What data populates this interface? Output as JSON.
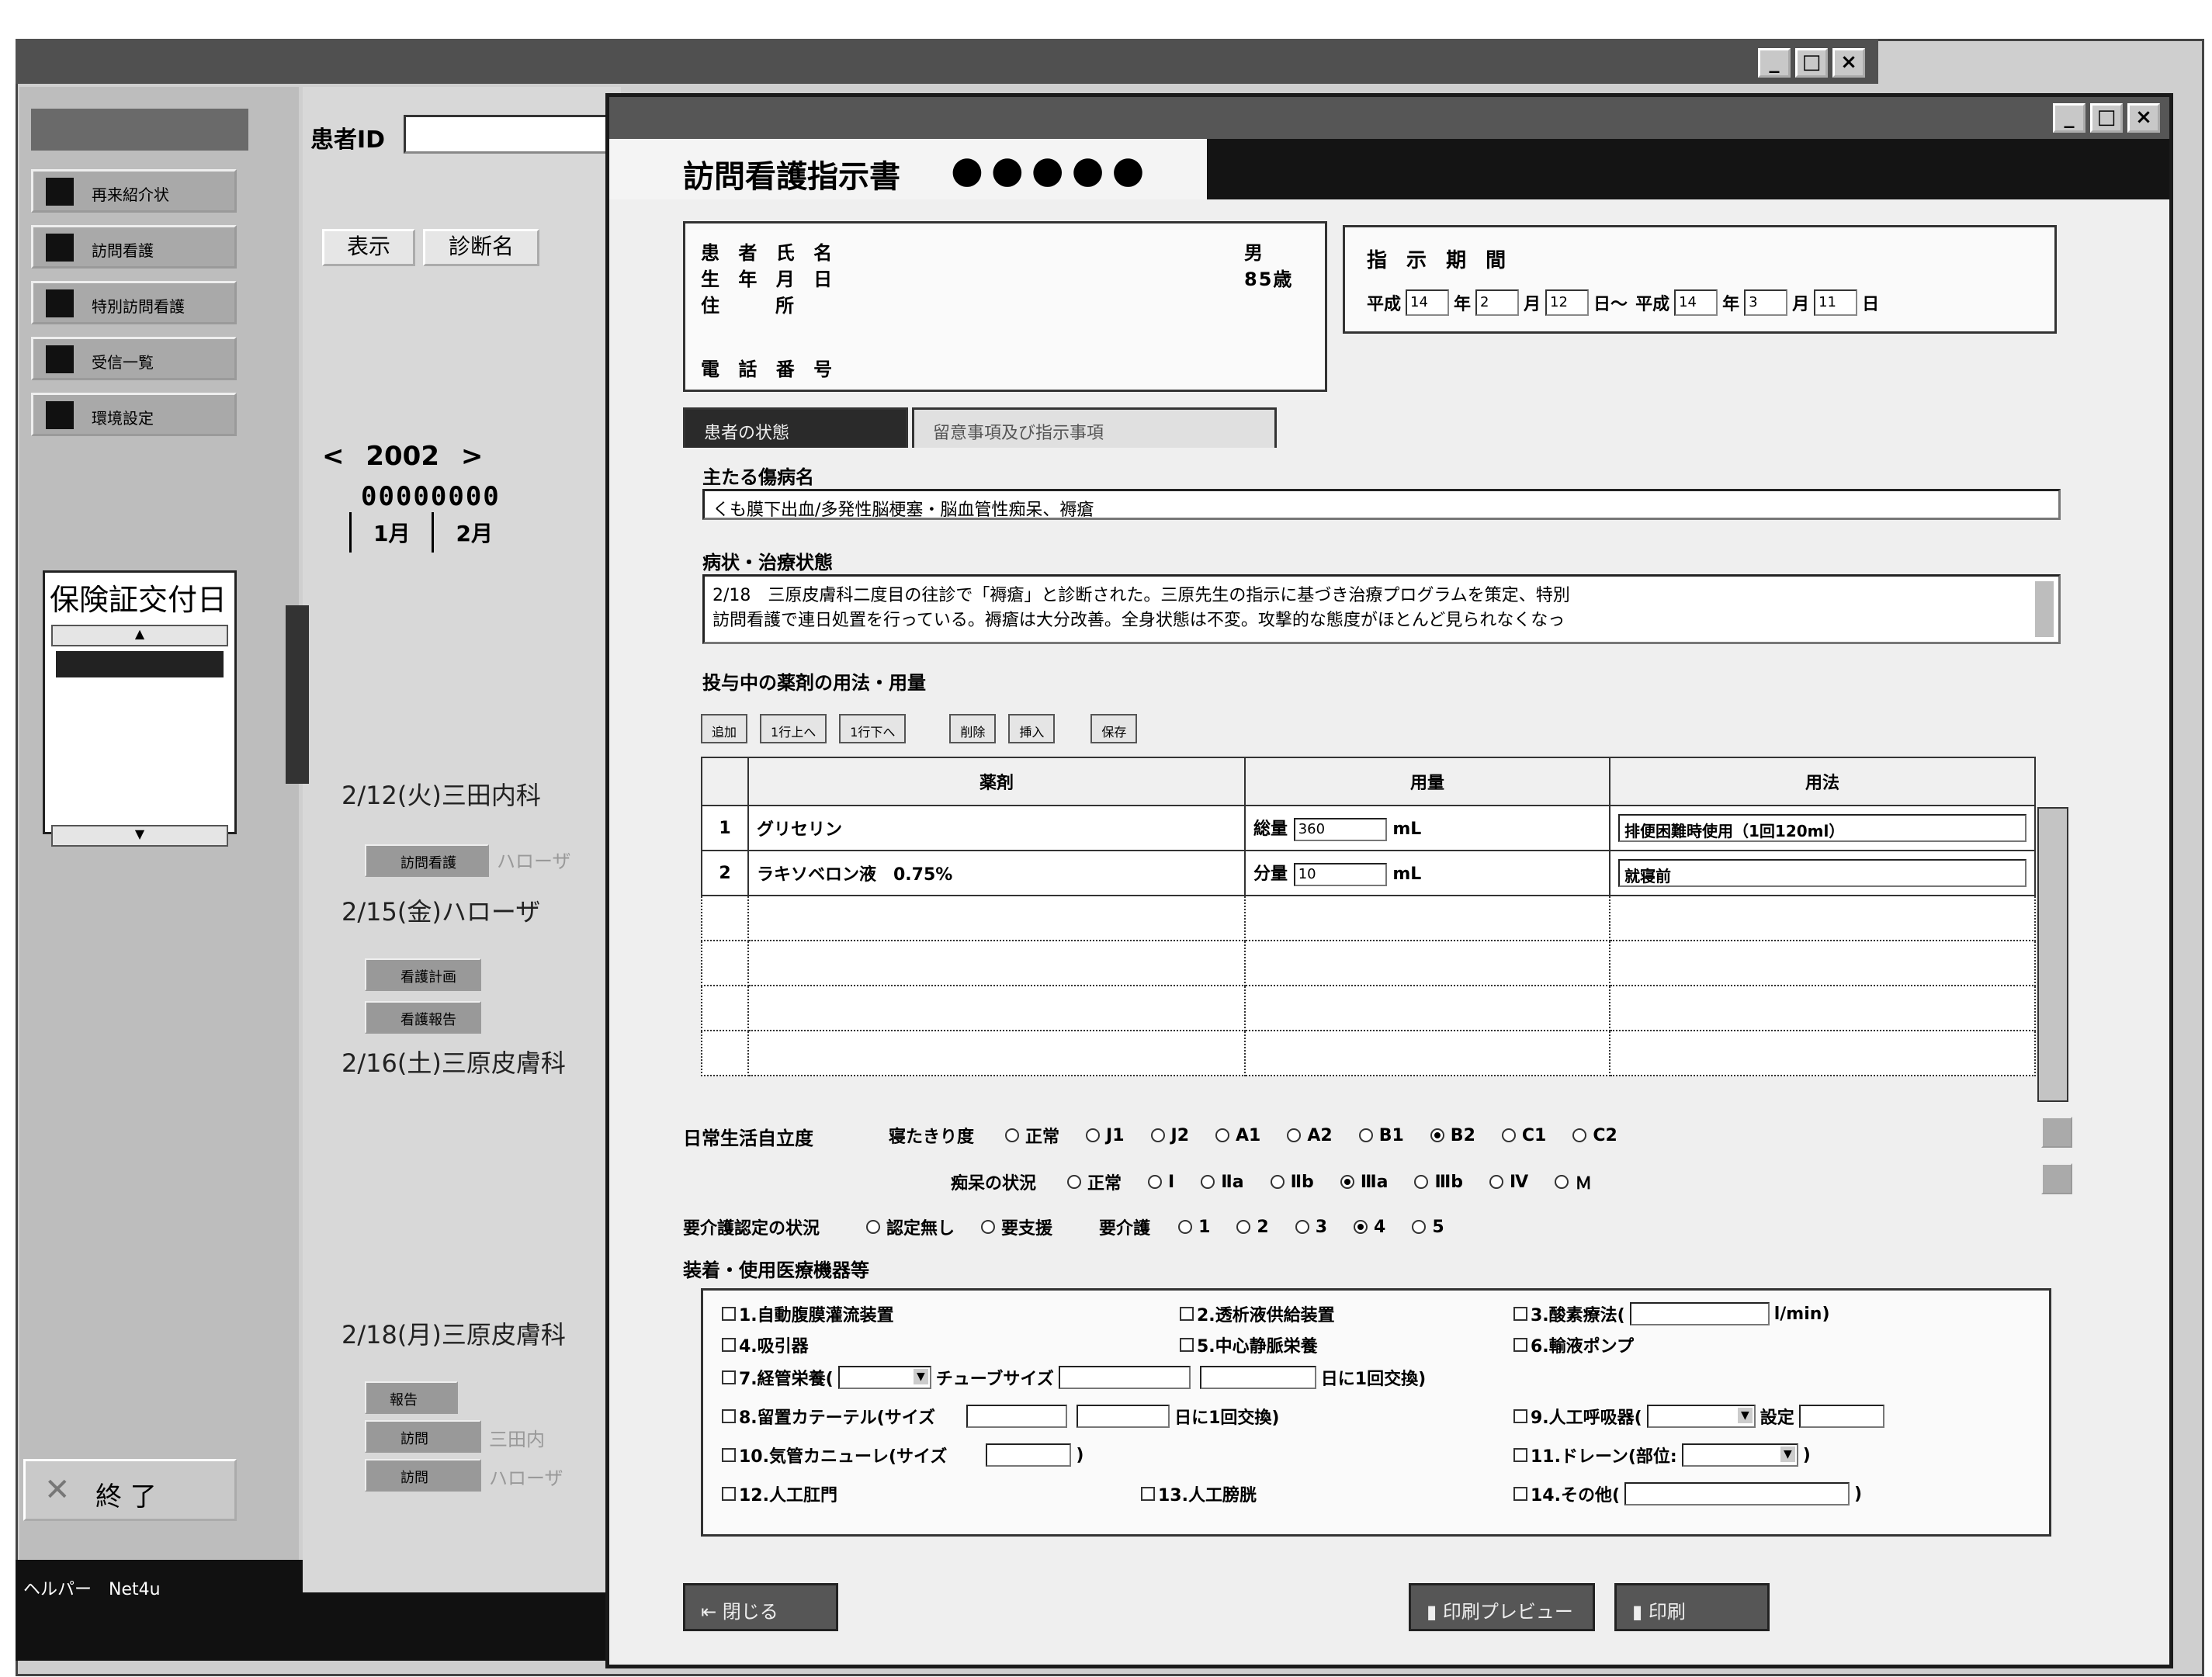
{
  "background_app": {
    "minimize_label": "_",
    "maximize_label": "□",
    "close_label": "×",
    "patient_id_label": "患者ID",
    "nav_items": [
      "再来紹介状",
      "訪問看護",
      "特別訪問看護",
      "受信一覧",
      "環境設定"
    ],
    "display_button": "表示",
    "diagnosis_button": "診断名",
    "year": "2002",
    "year_prev": "<",
    "year_next": ">",
    "digits_row": "00000000",
    "months": [
      "1月",
      "2月"
    ],
    "card_title": "保険証交付日",
    "card_up": "▲",
    "card_down": "▼",
    "schedule": [
      {
        "date": "2/12(火)三田内科"
      },
      {
        "date": "2/15(金)ハローザ"
      },
      {
        "date": "2/16(土)三原皮膚科"
      },
      {
        "date": "2/18(月)三原皮膚科"
      }
    ],
    "schedule_buttons": [
      "訪問看護",
      "看護計画",
      "看護報告",
      "報告",
      "訪問"
    ],
    "schedule_tags": [
      "ハローザ",
      "三田内",
      "ハローザ"
    ],
    "exit_label": "終 了",
    "taskbar_text": "ヘルパー　Net4u"
  },
  "dialog": {
    "minimize_label": "_",
    "maximize_label": "□",
    "close_label": "×",
    "header_title": "訪問看護指示書",
    "header_dots": "●●●●●",
    "patient": {
      "name_label": "患 者 氏 名",
      "sex_value": "男",
      "dob_label": "生 年 月 日",
      "age_value": "85歳",
      "address_label": "住　　所",
      "phone_label": "電 話 番 号"
    },
    "period": {
      "title": "指 示 期 間",
      "era1": "平成",
      "year1": "14",
      "year_unit1": "年",
      "month1": "2",
      "month_unit1": "月",
      "day1": "12",
      "day_unit1": "日～",
      "era2": "平成",
      "year2": "14",
      "year_unit2": "年",
      "month2": "3",
      "month_unit2": "月",
      "day2": "11",
      "day_unit2": "日"
    },
    "tabs": [
      "患者の状態",
      "留意事項及び指示事項"
    ],
    "main_disease_label": "主たる傷病名",
    "main_disease_value": "くも膜下出血/多発性脳梗塞・脳血管性痴呆、褥瘡",
    "condition_label": "病状・治療状態",
    "condition_line1": "2/18　三原皮膚科二度目の往診で「褥瘡」と診断された。三原先生の指示に基づき治療プログラムを策定、特別",
    "condition_line2": "訪問看護で連日処置を行っている。褥瘡は大分改善。全身状態は不変。攻撃的な態度がほとんど見られなくなっ",
    "med_label": "投与中の薬剤の用法・用量",
    "toolbar": [
      "追加",
      "1行上へ",
      "1行下へ",
      "削除",
      "挿入",
      "保存"
    ],
    "table": {
      "headers": [
        "薬剤",
        "用量",
        "用法"
      ],
      "rows": [
        {
          "num": "1",
          "drug": "グリセリン",
          "dose_prefix": "総量",
          "dose_value": "360",
          "dose_unit": "mL",
          "usage": "排便困難時使用（1回120ml）"
        },
        {
          "num": "2",
          "drug": "ラキソベロン液　0.75%",
          "dose_prefix": "分量",
          "dose_value": "10",
          "dose_unit": "mL",
          "usage": "就寝前"
        }
      ]
    },
    "adl": {
      "label": "日常生活自立度",
      "bedridden_label": "寝たきり度",
      "bedridden_options": [
        "正常",
        "J1",
        "J2",
        "A1",
        "A2",
        "B1",
        "B2",
        "C1",
        "C2"
      ],
      "bedridden_selected": "B2",
      "dementia_label": "痴呆の状況",
      "dementia_options": [
        "正常",
        "Ⅰ",
        "Ⅱa",
        "Ⅱb",
        "Ⅲa",
        "Ⅲb",
        "Ⅳ",
        "Ｍ"
      ],
      "dementia_selected": "Ⅲa"
    },
    "care": {
      "label": "要介護認定の状況",
      "options": [
        "認定無し",
        "要支援"
      ],
      "level_label": "要介護",
      "levels": [
        "1",
        "2",
        "3",
        "4",
        "5"
      ],
      "level_selected": "4"
    },
    "equipment": {
      "label": "装着・使用医療機器等",
      "items": [
        "1.自動腹膜灌流装置",
        "2.透析液供給装置",
        "3.酸素療法(",
        "l/min)",
        "4.吸引器",
        "5.中心静脈栄養",
        "6.輸液ポンプ",
        "7.経管栄養(",
        "チューブサイズ",
        "日に1回交換)",
        "8.留置カテーテル(サイズ",
        "日に1回交換)",
        "9.人工呼吸器(",
        "設定",
        "10.気管カニューレ(サイズ",
        ")",
        "11.ドレーン(部位:",
        ")",
        "12.人工肛門",
        "13.人工膀胱",
        "14.その他(",
        ")"
      ]
    },
    "footer_buttons": [
      "閉じる",
      "印刷プレビュー",
      "印刷"
    ]
  }
}
